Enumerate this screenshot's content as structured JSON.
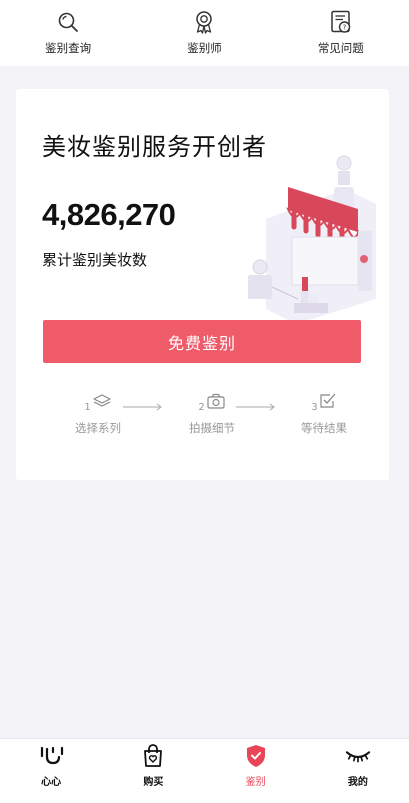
{
  "top_nav": {
    "items": [
      {
        "label": "鉴别查询",
        "icon": "search-icon"
      },
      {
        "label": "鉴别师",
        "icon": "badge-icon"
      },
      {
        "label": "常见问题",
        "icon": "faq-document-icon"
      }
    ]
  },
  "hero": {
    "title": "美妆鉴别服务开创者",
    "count": "4,826,270",
    "count_label": "累计鉴别美妆数",
    "cta_label": "免费鉴别"
  },
  "steps": [
    {
      "number": "1",
      "label": "选择系列",
      "icon": "layers-icon"
    },
    {
      "number": "2",
      "label": "拍摄细节",
      "icon": "camera-icon"
    },
    {
      "number": "3",
      "label": "等待结果",
      "icon": "check-square-icon"
    }
  ],
  "tab_bar": {
    "items": [
      {
        "label": "心心",
        "icon": "xinxin-logo-icon"
      },
      {
        "label": "购买",
        "icon": "shopping-bag-icon"
      },
      {
        "label": "鉴别",
        "icon": "shield-check-icon",
        "active": true
      },
      {
        "label": "我的",
        "icon": "eyelash-icon"
      }
    ]
  },
  "colors": {
    "accent": "#f05b6a",
    "active_tab": "#e94558",
    "background": "#f4f3f8"
  }
}
